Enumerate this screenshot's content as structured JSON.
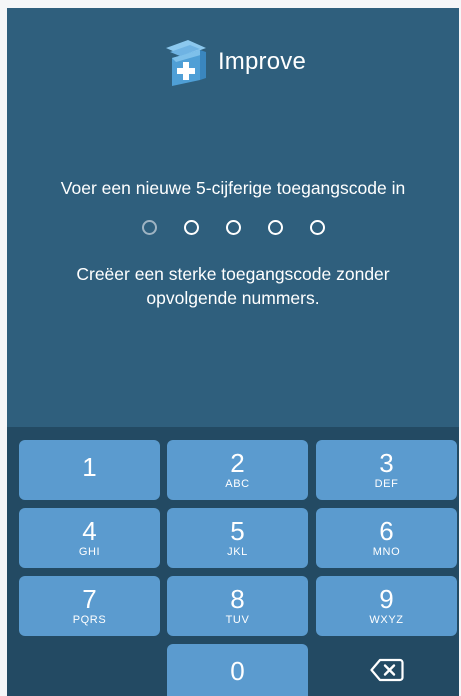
{
  "app": {
    "brand_name": "Improve"
  },
  "passcode": {
    "prompt": "Voer een nieuwe 5-cijferige toegangscode in",
    "hint": "Creëer een sterke toegangscode zonder opvolgende nummers.",
    "digits_total": 5,
    "digits_entered": 0
  },
  "keypad": {
    "keys": [
      {
        "digit": "1",
        "letters": ""
      },
      {
        "digit": "2",
        "letters": "ABC"
      },
      {
        "digit": "3",
        "letters": "DEF"
      },
      {
        "digit": "4",
        "letters": "GHI"
      },
      {
        "digit": "5",
        "letters": "JKL"
      },
      {
        "digit": "6",
        "letters": "MNO"
      },
      {
        "digit": "7",
        "letters": "PQRS"
      },
      {
        "digit": "8",
        "letters": "TUV"
      },
      {
        "digit": "9",
        "letters": "WXYZ"
      },
      {
        "digit": "0",
        "letters": ""
      }
    ],
    "delete_icon": "backspace-icon"
  },
  "colors": {
    "background": "#2f5f7d",
    "keypad_background": "#234a63",
    "key": "#5b9bcf",
    "logo_box": "#4f9fd6"
  }
}
